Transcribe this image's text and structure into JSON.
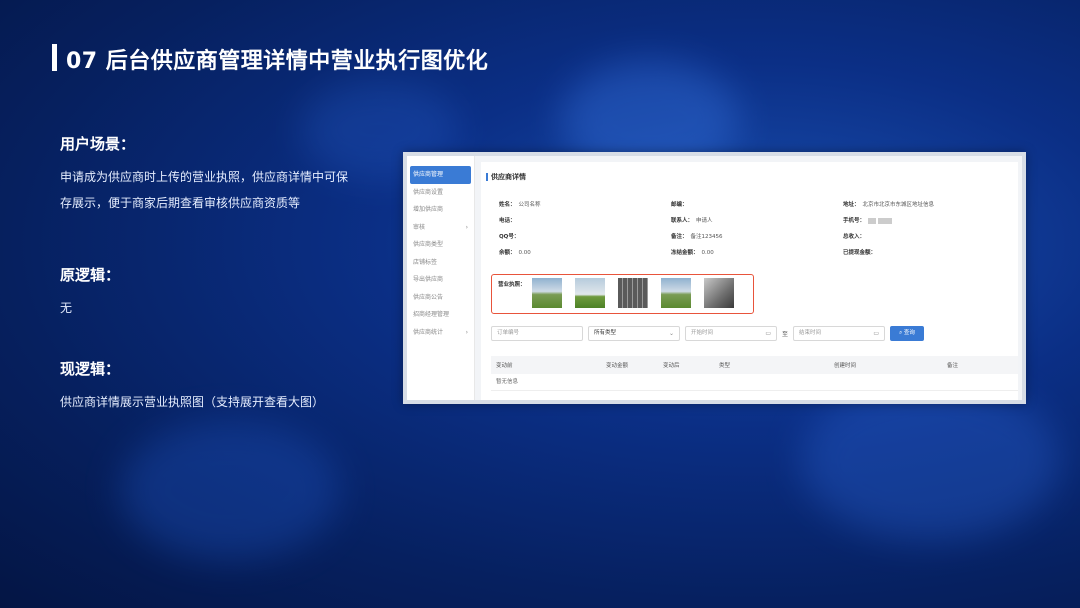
{
  "slide": {
    "title": "07 后台供应商管理详情中营业执行图优化",
    "sections": [
      {
        "heading": "用户场景：",
        "lines": [
          "申请成为供应商时上传的营业执照，供应商详情中可保",
          "存展示，便于商家后期查看审核供应商资质等"
        ]
      },
      {
        "heading": "原逻辑：",
        "lines": [
          "无"
        ]
      },
      {
        "heading": "现逻辑：",
        "lines": [
          "供应商详情展示营业执照图（支持展开查看大图）"
        ]
      }
    ]
  },
  "app": {
    "sidebar": [
      {
        "label": "供应商管理",
        "active": true
      },
      {
        "label": "供应商设置"
      },
      {
        "label": "增加供应商"
      },
      {
        "label": "审核",
        "chevron": "›"
      },
      {
        "label": "供应商类型"
      },
      {
        "label": "店铺标签"
      },
      {
        "label": "导出供应商"
      },
      {
        "label": "供应商公告"
      },
      {
        "label": "招商经理管理"
      },
      {
        "label": "供应商统计",
        "chevron": "›"
      }
    ],
    "panel_title": "供应商详情",
    "info": [
      {
        "k": "姓名：",
        "v": "公司名称"
      },
      {
        "k": "邮编：",
        "v": ""
      },
      {
        "k": "地址：",
        "v": "北京市北京市东城区地址信息"
      },
      {
        "k": "电话：",
        "v": ""
      },
      {
        "k": "联系人：",
        "v": "申请人"
      },
      {
        "k": "手机号：",
        "v": ""
      },
      {
        "k": "QQ号：",
        "v": ""
      },
      {
        "k": "备注：",
        "v": "备注123456"
      },
      {
        "k": "总收入：",
        "v": ""
      },
      {
        "k": "余额：",
        "v": "0.00"
      },
      {
        "k": "冻结金额：",
        "v": "0.00"
      },
      {
        "k": "已提现金额：",
        "v": ""
      }
    ],
    "license_label": "营业执照：",
    "filters": {
      "order_no": "订单编号",
      "type": "所有类型",
      "start": "开始时间",
      "to": "至",
      "end": "结束时间",
      "search": "查询",
      "search_icon": "search-icon",
      "calendar_icon": "calendar-icon",
      "chevron_icon": "chevron-down-icon"
    },
    "table": {
      "headers": [
        "变动前",
        "变动金额",
        "变动后",
        "类型",
        "创建时间",
        "备注"
      ],
      "empty": "暂无信息"
    }
  }
}
